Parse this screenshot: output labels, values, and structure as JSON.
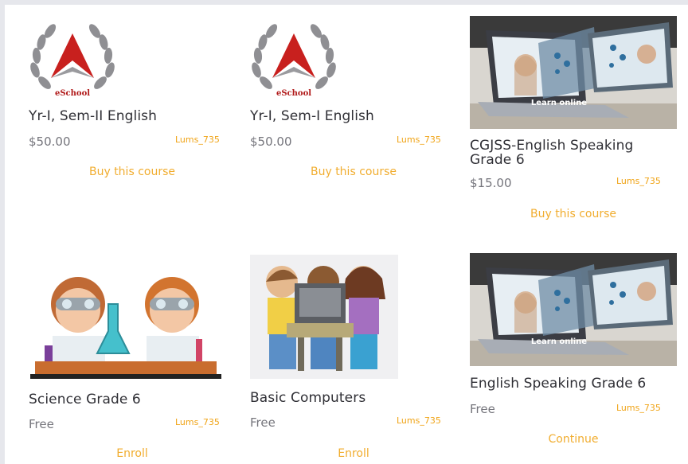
{
  "courses": [
    {
      "title": "Yr-I, Sem-II English",
      "price": "$50.00",
      "author": "Lums_735",
      "action": "Buy this course",
      "image": "eschool-logo",
      "logo_text": "eSchool"
    },
    {
      "title": "Yr-I, Sem-I English",
      "price": "$50.00",
      "author": "Lums_735",
      "action": "Buy this course",
      "image": "eschool-logo",
      "logo_text": "eSchool"
    },
    {
      "title": "CGJSS-English Speaking Grade 6",
      "price": "$15.00",
      "author": "Lums_735",
      "action": "Buy this course",
      "image": "laptop-learn-online",
      "banner_text": "Learn online"
    },
    {
      "title": "Science Grade 6",
      "price": "Free",
      "author": "Lums_735",
      "action": "Enroll",
      "image": "kids-science-lab"
    },
    {
      "title": "Basic Computers",
      "price": "Free",
      "author": "Lums_735",
      "action": "Enroll",
      "image": "kids-computer"
    },
    {
      "title": "English Speaking Grade 6",
      "price": "Free",
      "author": "Lums_735",
      "action": "Continue",
      "image": "laptop-learn-online",
      "banner_text": "Learn online"
    }
  ],
  "colors": {
    "accent": "#f1ad2f",
    "title": "#2f2f35",
    "price": "#75757c",
    "logo_red": "#c8201e"
  }
}
